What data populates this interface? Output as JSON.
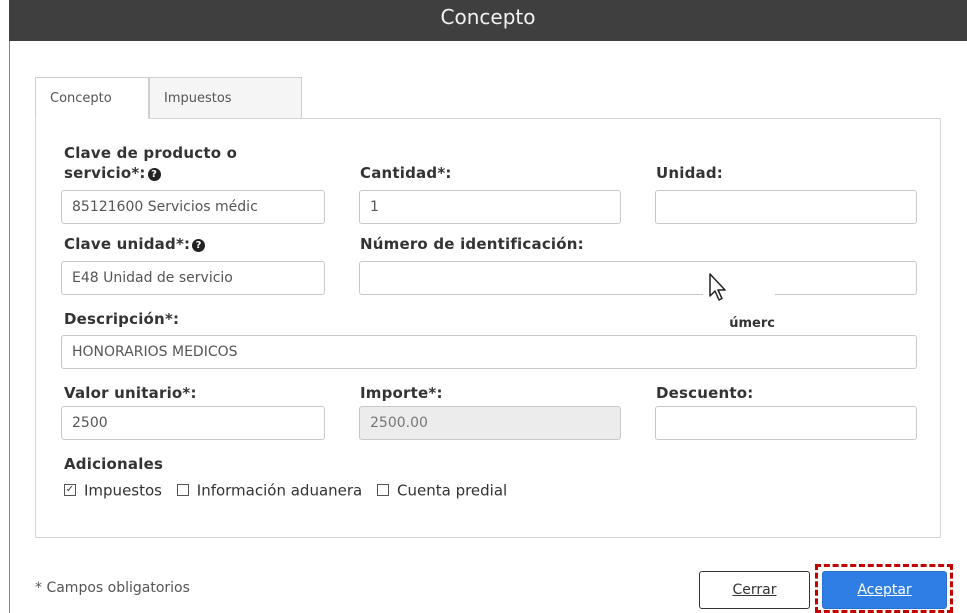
{
  "dialog": {
    "title": "Concepto"
  },
  "tabs": [
    {
      "label": "Concepto",
      "active": true
    },
    {
      "label": "Impuestos",
      "active": false
    }
  ],
  "form": {
    "clave_producto": {
      "label_line1": "Clave de producto o",
      "label_line2": "servicio*:",
      "value": "85121600 Servicios médic",
      "help_icon": "question-circle-icon"
    },
    "cantidad": {
      "label": "Cantidad*:",
      "value": "1"
    },
    "unidad": {
      "label": "Unidad:",
      "value": ""
    },
    "clave_unidad": {
      "label": "Clave unidad*:",
      "value": "E48 Unidad de servicio",
      "help_icon": "question-circle-icon"
    },
    "numero_identificacion": {
      "label": "Número de identificación:",
      "value": ""
    },
    "descripcion": {
      "label": "Descripción*:",
      "value": "HONORARIOS MEDICOS"
    },
    "valor_unitario": {
      "label": "Valor unitario*:",
      "value": "2500"
    },
    "importe": {
      "label": "Importe*:",
      "value": "2500.00"
    },
    "descuento": {
      "label": "Descuento:",
      "value": ""
    }
  },
  "adicionales": {
    "label": "Adicionales",
    "options": [
      {
        "label": "Impuestos",
        "checked": true
      },
      {
        "label": "Información aduanera",
        "checked": false
      },
      {
        "label": "Cuenta predial",
        "checked": false
      }
    ]
  },
  "overlay_fragment": "úmerc",
  "footer": {
    "required_note": "* Campos obligatorios",
    "close_label": "Cerrar",
    "accept_label": "Aceptar"
  },
  "colors": {
    "titlebar": "#3f3f3f",
    "accent": "#2e7ee6",
    "highlight": "#c40000"
  }
}
